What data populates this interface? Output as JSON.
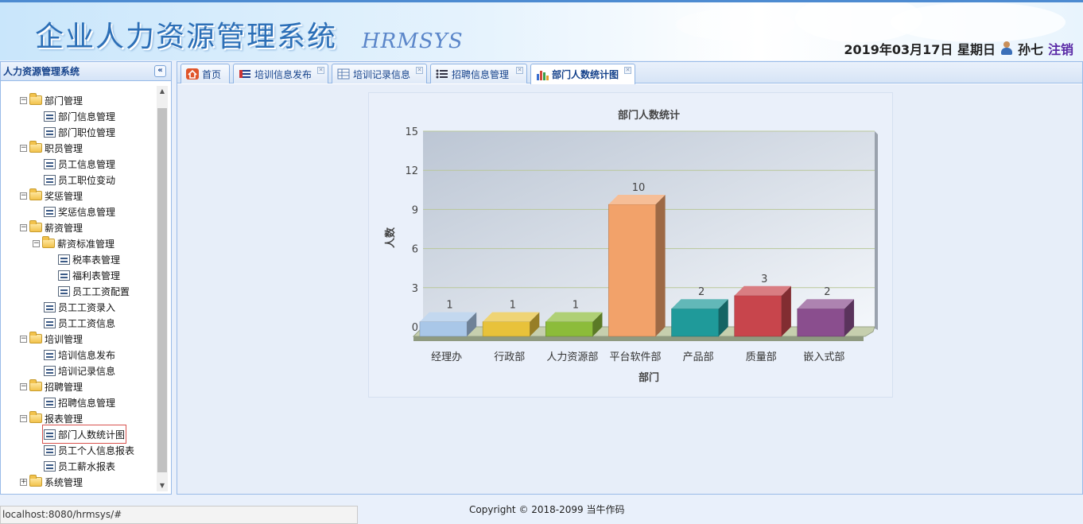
{
  "header": {
    "title": "企业人力资源管理系统",
    "subtitle": "HRMSYS",
    "date": "2019年03月17日 星期日",
    "user": "孙七",
    "logout": "注销"
  },
  "sidebar": {
    "title": "人力资源管理系统",
    "nodes": [
      {
        "label": "部门管理",
        "type": "folder",
        "level": 1
      },
      {
        "label": "部门信息管理",
        "type": "leaf",
        "level": 2
      },
      {
        "label": "部门职位管理",
        "type": "leaf",
        "level": 2
      },
      {
        "label": "职员管理",
        "type": "folder",
        "level": 1
      },
      {
        "label": "员工信息管理",
        "type": "leaf",
        "level": 2
      },
      {
        "label": "员工职位变动",
        "type": "leaf",
        "level": 2
      },
      {
        "label": "奖惩管理",
        "type": "folder",
        "level": 1
      },
      {
        "label": "奖惩信息管理",
        "type": "leaf",
        "level": 2
      },
      {
        "label": "薪资管理",
        "type": "folder",
        "level": 1
      },
      {
        "label": "薪资标准管理",
        "type": "folder",
        "level": 2
      },
      {
        "label": "税率表管理",
        "type": "leaf",
        "level": 3
      },
      {
        "label": "福利表管理",
        "type": "leaf",
        "level": 3
      },
      {
        "label": "员工工资配置",
        "type": "leaf",
        "level": 3
      },
      {
        "label": "员工工资录入",
        "type": "leaf",
        "level": 2
      },
      {
        "label": "员工工资信息",
        "type": "leaf",
        "level": 2
      },
      {
        "label": "培训管理",
        "type": "folder",
        "level": 1
      },
      {
        "label": "培训信息发布",
        "type": "leaf",
        "level": 2
      },
      {
        "label": "培训记录信息",
        "type": "leaf",
        "level": 2
      },
      {
        "label": "招聘管理",
        "type": "folder",
        "level": 1
      },
      {
        "label": "招聘信息管理",
        "type": "leaf",
        "level": 2
      },
      {
        "label": "报表管理",
        "type": "folder",
        "level": 1
      },
      {
        "label": "部门人数统计图",
        "type": "leaf",
        "level": 2,
        "selected": true
      },
      {
        "label": "员工个人信息报表",
        "type": "leaf",
        "level": 2
      },
      {
        "label": "员工薪水报表",
        "type": "leaf",
        "level": 2
      },
      {
        "label": "系统管理",
        "type": "folder",
        "level": 1,
        "collapsed": true
      }
    ]
  },
  "tabs": [
    {
      "label": "首页",
      "icon": "home-icon"
    },
    {
      "label": "培训信息发布",
      "icon": "list-icon",
      "closable": true
    },
    {
      "label": "培训记录信息",
      "icon": "table-icon",
      "closable": true
    },
    {
      "label": "招聘信息管理",
      "icon": "bullet-list-icon",
      "closable": true
    },
    {
      "label": "部门人数统计图",
      "icon": "bar-chart-icon",
      "closable": true,
      "active": true
    }
  ],
  "chart_data": {
    "type": "bar",
    "title": "部门人数统计",
    "xlabel": "部门",
    "ylabel": "人数",
    "categories": [
      "经理办",
      "行政部",
      "人力资源部",
      "平台软件部",
      "产品部",
      "质量部",
      "嵌入式部"
    ],
    "values": [
      1,
      1,
      1,
      10,
      2,
      3,
      2
    ],
    "ylim": [
      0,
      15
    ],
    "yticks": [
      0,
      3,
      6,
      9,
      12,
      15
    ],
    "grid": true,
    "colors": [
      "#a9c7e8",
      "#e8c23a",
      "#8cbc3a",
      "#f2a26a",
      "#1f9a9a",
      "#c8454c",
      "#8a4e8e"
    ]
  },
  "status": {
    "url": "localhost:8080/hrmsys/#"
  },
  "footer": {
    "copyright": "Copyright © 2018-2099 当牛作码"
  }
}
